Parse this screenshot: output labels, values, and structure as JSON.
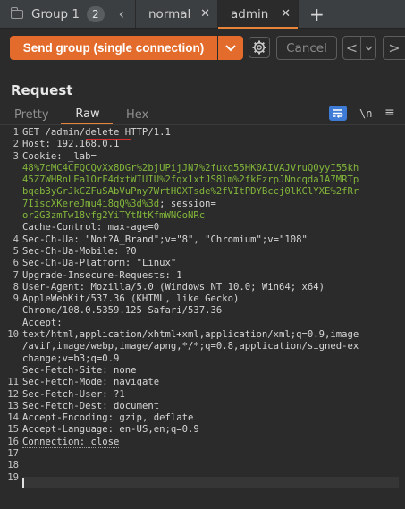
{
  "tabs": {
    "group_label": "Group 1",
    "group_count": "2",
    "normal_label": "normal",
    "admin_label": "admin",
    "add_symbol": "+"
  },
  "toolbar": {
    "send_label": "Send group (single connection)",
    "cancel_label": "Cancel",
    "prev_symbol": "<",
    "next_symbol": ">",
    "accent_color": "#e36b2c"
  },
  "request": {
    "title": "Request",
    "view_tabs": [
      "Pretty",
      "Raw",
      "Hex"
    ],
    "newline_toggle": "\\n"
  },
  "editor": {
    "line_numbers": [
      "1",
      "2",
      "3",
      "",
      "",
      "",
      "",
      "",
      "",
      "4",
      "5",
      "6",
      "7",
      "8",
      "9",
      "",
      "",
      "10",
      "",
      "",
      "",
      "11",
      "12",
      "13",
      "14",
      "15",
      "16",
      "17",
      "18",
      "19"
    ],
    "lines": [
      {
        "k": "GET /admin/delete HTTP/1.1",
        "v": ""
      },
      {
        "k": "Host",
        "v": ": 192.168.0.1"
      },
      {
        "k": "Cookie",
        "v": ": _lab="
      },
      {
        "ck": "48%7cMC4CFQCQvXx8DGr%2bjUPijJN7%2fuxq55HK0AIVAJVruQ0yyI55kh"
      },
      {
        "ck": "45Z7WHRnLEalOrF4dxtWIUIU%2fqx1xtJS8lm%2fkFzrpJNncqda1A7MRTp"
      },
      {
        "ck": "bqeb3yGrJkCZFuSAbVuPny7WrtHOXTsde%2fVItPDYBccj0lKClYXE%2fRr"
      },
      {
        "ck": "7IiscXKereJmu4i8gQ%3d%3d",
        "v": "; session="
      },
      {
        "ck": "or2G3zmTw18vfg2YiTYtNtKfmWNGoNRc"
      },
      {
        "k": "Cache-Control",
        "v": ": max-age=0"
      },
      {
        "k": "Sec-Ch-Ua",
        "v": ": \"Not?A_Brand\";v=\"8\", \"Chromium\";v=\"108\""
      },
      {
        "k": "Sec-Ch-Ua-Mobile",
        "v": ": ?0"
      },
      {
        "k": "Sec-Ch-Ua-Platform",
        "v": ": \"Linux\""
      },
      {
        "k": "Upgrade-Insecure-Requests",
        "v": ": 1"
      },
      {
        "k": "User-Agent",
        "v": ": Mozilla/5.0 (Windows NT 10.0; Win64; x64)"
      },
      {
        "v": "AppleWebKit/537.36 (KHTML, like Gecko)"
      },
      {
        "v": "Chrome/108.0.5359.125 Safari/537.36"
      },
      {
        "k": "Accept",
        "v": ":"
      },
      {
        "v": "text/html,application/xhtml+xml,application/xml;q=0.9,image"
      },
      {
        "v": "/avif,image/webp,image/apng,*/*;q=0.8,application/signed-ex"
      },
      {
        "v": "change;v=b3;q=0.9"
      },
      {
        "k": "Sec-Fetch-Site",
        "v": ": none"
      },
      {
        "k": "Sec-Fetch-Mode",
        "v": ": navigate"
      },
      {
        "k": "Sec-Fetch-User",
        "v": ": ?1"
      },
      {
        "k": "Sec-Fetch-Dest",
        "v": ": document"
      },
      {
        "k": "Accept-Encoding",
        "v": ": gzip, deflate"
      },
      {
        "k": "Accept-Language",
        "v": ": en-US,en;q=0.9"
      },
      {
        "k": "Connection",
        "v": ": close"
      },
      {
        "v": ""
      },
      {
        "v": ""
      }
    ]
  }
}
